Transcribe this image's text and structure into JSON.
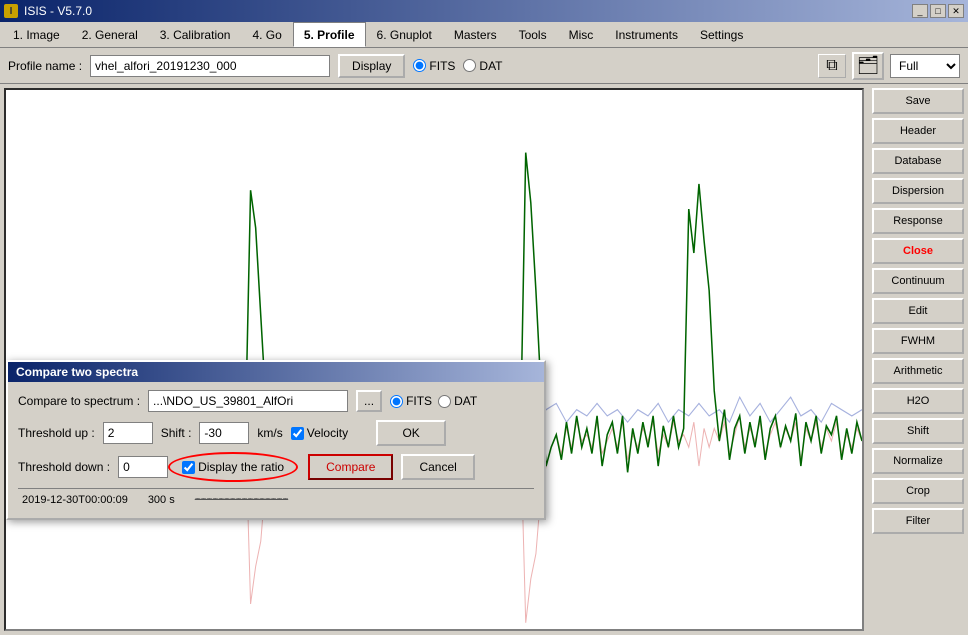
{
  "titlebar": {
    "icon": "I",
    "title": "ISIS - V5.7.0",
    "minimize": "_",
    "maximize": "□",
    "close": "✕"
  },
  "menubar": {
    "items": [
      {
        "id": "image",
        "label": "1. Image"
      },
      {
        "id": "general",
        "label": "2. General"
      },
      {
        "id": "calibration",
        "label": "3. Calibration"
      },
      {
        "id": "go",
        "label": "4. Go"
      },
      {
        "id": "profile",
        "label": "5. Profile",
        "active": true
      },
      {
        "id": "gnuplot",
        "label": "6. Gnuplot"
      },
      {
        "id": "masters",
        "label": "Masters"
      },
      {
        "id": "tools",
        "label": "Tools"
      },
      {
        "id": "misc",
        "label": "Misc"
      },
      {
        "id": "instruments",
        "label": "Instruments"
      },
      {
        "id": "settings",
        "label": "Settings"
      }
    ]
  },
  "toolbar": {
    "profile_label": "Profile name :",
    "profile_value": "vhel_alfori_20191230_000",
    "display_btn": "Display",
    "fits_label": "FITS",
    "dat_label": "DAT",
    "view_mode": "Full"
  },
  "sidebar": {
    "buttons": [
      {
        "id": "save",
        "label": "Save"
      },
      {
        "id": "header",
        "label": "Header"
      },
      {
        "id": "database",
        "label": "Database"
      },
      {
        "id": "dispersion",
        "label": "Dispersion"
      },
      {
        "id": "response",
        "label": "Response"
      },
      {
        "id": "close",
        "label": "Close",
        "style": "close"
      },
      {
        "id": "continuum",
        "label": "Continuum"
      },
      {
        "id": "edit",
        "label": "Edit"
      },
      {
        "id": "fwhm",
        "label": "FWHM"
      },
      {
        "id": "arithmetic",
        "label": "Arithmetic"
      },
      {
        "id": "h2o",
        "label": "H2O"
      },
      {
        "id": "shift",
        "label": "Shift"
      },
      {
        "id": "normalize",
        "label": "Normalize"
      },
      {
        "id": "crop",
        "label": "Crop"
      },
      {
        "id": "filter",
        "label": "Filter"
      }
    ]
  },
  "dialog": {
    "title": "Compare two spectra",
    "compare_label": "Compare to spectrum :",
    "spectrum_value": "...\\NDO_US_39801_AlfOri",
    "browse_label": "...",
    "fits_label": "FITS",
    "dat_label": "DAT",
    "threshold_up_label": "Threshold up :",
    "threshold_up_value": "2",
    "shift_label": "Shift :",
    "shift_value": "-30",
    "km_s_label": "km/s",
    "velocity_label": "Velocity",
    "threshold_down_label": "Threshold down :",
    "threshold_down_value": "0",
    "display_ratio_label": "Display the ratio",
    "ok_label": "OK",
    "compare_btn_label": "Compare",
    "cancel_label": "Cancel"
  },
  "statusbar": {
    "datetime": "2019-12-30T00:00:09",
    "duration": "300 s"
  },
  "chart": {
    "x_min": 0,
    "x_max": 100,
    "y_min": -1,
    "y_max": 3
  }
}
